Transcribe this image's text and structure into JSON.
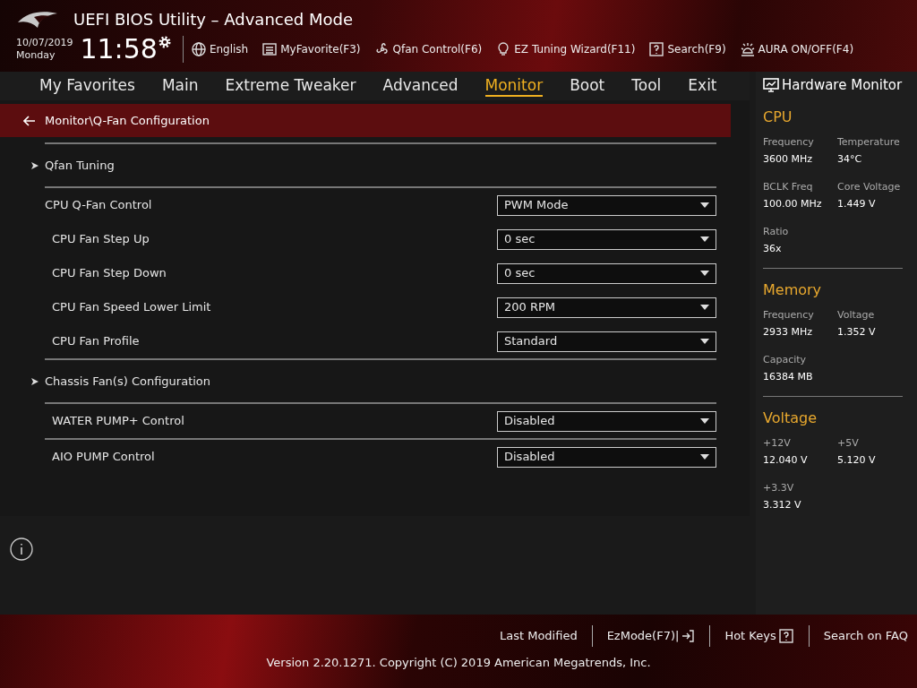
{
  "header": {
    "title": "UEFI BIOS Utility – Advanced Mode",
    "date": "10/07/2019",
    "day": "Monday",
    "time": "11:58",
    "tools": [
      {
        "kind": "globe",
        "label": "English"
      },
      {
        "kind": "list",
        "label": "MyFavorite(F3)"
      },
      {
        "kind": "fan",
        "label": "Qfan Control(F6)"
      },
      {
        "kind": "bulb",
        "label": "EZ Tuning Wizard(F11)"
      },
      {
        "kind": "question",
        "label": "Search(F9)"
      },
      {
        "kind": "aura",
        "label": "AURA ON/OFF(F4)"
      }
    ]
  },
  "tabs": [
    {
      "label": "My Favorites",
      "selected": false
    },
    {
      "label": "Main",
      "selected": false
    },
    {
      "label": "Extreme Tweaker",
      "selected": false
    },
    {
      "label": "Advanced",
      "selected": false
    },
    {
      "label": "Monitor",
      "selected": true
    },
    {
      "label": "Boot",
      "selected": false
    },
    {
      "label": "Tool",
      "selected": false
    },
    {
      "label": "Exit",
      "selected": false
    }
  ],
  "breadcrumb": "Monitor\\Q-Fan Configuration",
  "settings": [
    {
      "kind": "submenu",
      "label": "Qfan Tuning"
    },
    {
      "kind": "group-setting",
      "label": "CPU Q-Fan Control",
      "value": "PWM Mode"
    },
    {
      "kind": "sub-setting",
      "label": "CPU Fan Step Up",
      "value": "0 sec"
    },
    {
      "kind": "sub-setting",
      "label": "CPU Fan Step Down",
      "value": "0 sec"
    },
    {
      "kind": "sub-setting",
      "label": "CPU Fan Speed Lower Limit",
      "value": "200 RPM"
    },
    {
      "kind": "sub-setting",
      "label": "CPU Fan Profile",
      "value": "Standard"
    },
    {
      "kind": "submenu",
      "label": "Chassis Fan(s) Configuration"
    },
    {
      "kind": "setting",
      "label": "WATER PUMP+ Control",
      "value": "Disabled"
    },
    {
      "kind": "setting",
      "label": "AIO PUMP Control",
      "value": "Disabled"
    }
  ],
  "hardware_monitor": {
    "title": "Hardware Monitor",
    "sections": [
      {
        "title": "CPU",
        "fields": [
          {
            "label": "Frequency",
            "value": "3600 MHz"
          },
          {
            "label": "Temperature",
            "value": "34°C"
          },
          {
            "label": "BCLK Freq",
            "value": "100.00 MHz"
          },
          {
            "label": "Core Voltage",
            "value": "1.449 V"
          },
          {
            "label": "Ratio",
            "value": "36x"
          }
        ]
      },
      {
        "title": "Memory",
        "fields": [
          {
            "label": "Frequency",
            "value": "2933 MHz"
          },
          {
            "label": "Voltage",
            "value": "1.352 V"
          },
          {
            "label": "Capacity",
            "value": "16384 MB"
          }
        ]
      },
      {
        "title": "Voltage",
        "fields": [
          {
            "label": "+12V",
            "value": "12.040 V"
          },
          {
            "label": "+5V",
            "value": "5.120 V"
          },
          {
            "label": "+3.3V",
            "value": "3.312 V"
          }
        ]
      }
    ]
  },
  "footer": {
    "links": [
      {
        "label": "Last Modified",
        "kind": "plain"
      },
      {
        "label": "EzMode(F7)|",
        "kind": "exit"
      },
      {
        "label": "Hot Keys",
        "kind": "question"
      },
      {
        "label": "Search on FAQ",
        "kind": "plain"
      }
    ],
    "version": "Version 2.20.1271. Copyright (C) 2019 American Megatrends, Inc."
  }
}
